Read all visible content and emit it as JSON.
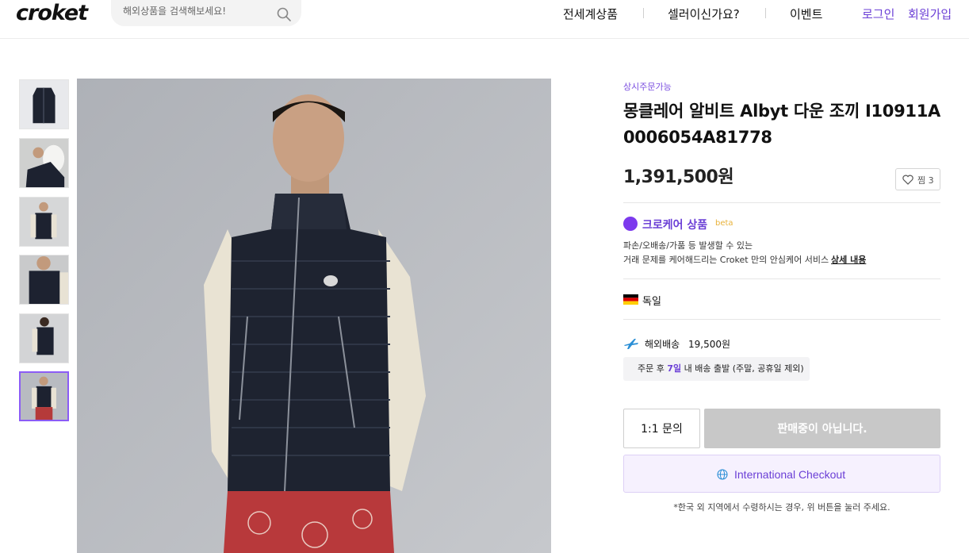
{
  "header": {
    "logo": "croket",
    "search_placeholder": "해외상품을 검색해보세요!",
    "nav": [
      "전세계상품",
      "셀러이신가요?",
      "이벤트"
    ],
    "login": "로그인",
    "signup": "회원가입"
  },
  "product": {
    "status_tag": "상시주문가능",
    "title": "몽클레어 알비트 Albyt 다운 조끼 I10911A 0006054A81778",
    "price": "1,391,500원",
    "wish_label": "찜 3",
    "care": {
      "title": "크로케어 상품",
      "beta": "beta",
      "desc_line1": "파손/오배송/가품 등 발생할 수 있는",
      "desc_line2": "거래 문제를 케어해드리는 Croket 만의 안심케어 서비스",
      "detail_link": "상세 내용"
    },
    "origin": "독일",
    "shipping": {
      "label": "해외배송",
      "fee": "19,500원",
      "note_prefix": "주문 후 ",
      "note_days": "7일",
      "note_suffix": " 내 배송 출발 (주말, 공휴일 제외)"
    },
    "buttons": {
      "inquiry": "1:1 문의",
      "buy": "판매중이 아닙니다.",
      "international": "International Checkout"
    },
    "intl_note": "*한국 외 지역에서 수령하시는 경우, 위 버튼을 눌러 주세요."
  },
  "colors": {
    "accent": "#6b3fd6",
    "disabled_button": "#c8c8c8",
    "intl_bg": "#f6f1fe"
  },
  "icons": [
    "search-icon",
    "heart-icon",
    "croket-care-icon",
    "germany-flag-icon",
    "airplane-icon",
    "globe-icon"
  ]
}
